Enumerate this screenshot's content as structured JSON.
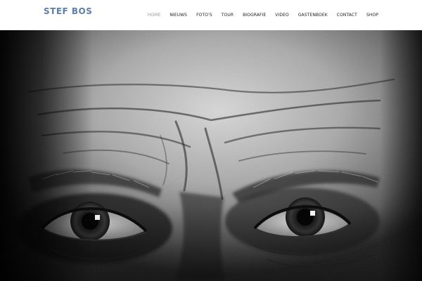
{
  "site": {
    "logo": "STEF BOS"
  },
  "nav": {
    "items": [
      {
        "label": "HOME",
        "active": true
      },
      {
        "label": "NIEUWS",
        "active": false
      },
      {
        "label": "FOTO'S",
        "active": false
      },
      {
        "label": "TOUR",
        "active": false
      },
      {
        "label": "BIOGRAFIE",
        "active": false
      },
      {
        "label": "VIDEO",
        "active": false
      },
      {
        "label": "GASTENBOEK",
        "active": false
      },
      {
        "label": "CONTACT",
        "active": false
      },
      {
        "label": "SHOP",
        "active": false
      }
    ]
  },
  "colors": {
    "logo": "#5b7fa6",
    "nav_text": "#222222",
    "nav_active": "#9a9a9a",
    "header_bg": "#ffffff"
  }
}
